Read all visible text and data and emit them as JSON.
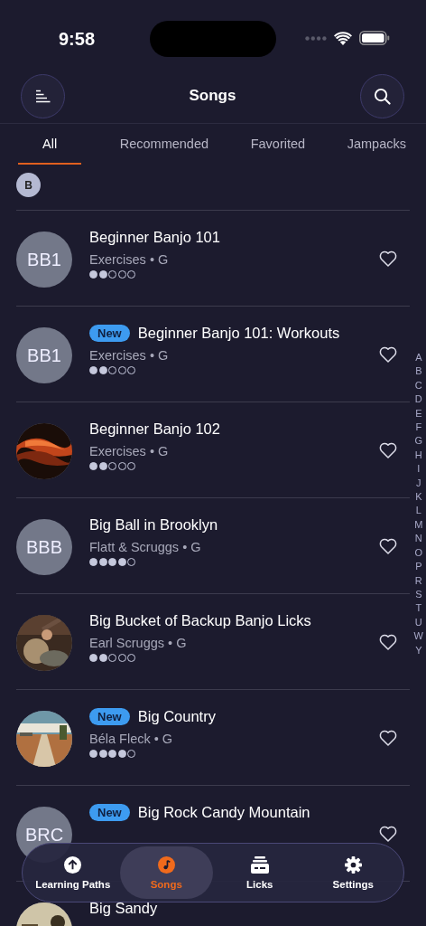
{
  "status_bar": {
    "time": "9:58"
  },
  "header": {
    "title": "Songs"
  },
  "tabs": [
    {
      "label": "All",
      "selected": true
    },
    {
      "label": "Recommended",
      "selected": false
    },
    {
      "label": "Favorited",
      "selected": false
    },
    {
      "label": "Jampacks",
      "selected": false
    }
  ],
  "section_letter": "B",
  "songs": [
    {
      "avatar": {
        "kind": "initials",
        "text": "BB1"
      },
      "title": "Beginner Banjo 101",
      "subtitle": "Exercises • G",
      "stars": 2,
      "favorited": false
    },
    {
      "avatar": {
        "kind": "initials",
        "text": "BB1"
      },
      "badge": "New",
      "title": "Beginner Banjo 101: Workouts",
      "subtitle": "Exercises • G",
      "stars": 2,
      "favorited": false
    },
    {
      "title": "Beginner Banjo 102",
      "subtitle": "Exercises • G",
      "stars": 2,
      "favorited": false
    },
    {
      "avatar": {
        "kind": "initials",
        "text": "BBB"
      },
      "title": "Big Ball in Brooklyn",
      "subtitle": "Flatt & Scruggs • G",
      "stars": 4,
      "favorited": false
    },
    {
      "title": "Big Bucket of Backup Banjo Licks",
      "subtitle": "Earl Scruggs • G",
      "stars": 2,
      "favorited": false
    },
    {
      "badge": "New",
      "title": "Big Country",
      "subtitle": "Béla Fleck • G",
      "stars": 4,
      "favorited": false
    },
    {
      "avatar": {
        "kind": "initials",
        "text": "BRC"
      },
      "badge": "New",
      "title": "Big Rock Candy Mountain",
      "favorited": false
    },
    {
      "title": "Big Sandy"
    }
  ],
  "alphabet": [
    "A",
    "B",
    "C",
    "D",
    "E",
    "F",
    "G",
    "H",
    "I",
    "J",
    "K",
    "L",
    "M",
    "N",
    "O",
    "P",
    "R",
    "S",
    "T",
    "U",
    "W",
    "Y"
  ],
  "bottom_nav": [
    {
      "label": "Learning Paths",
      "selected": false
    },
    {
      "label": "Songs",
      "selected": true
    },
    {
      "label": "Licks",
      "selected": false
    },
    {
      "label": "Settings",
      "selected": false
    }
  ]
}
